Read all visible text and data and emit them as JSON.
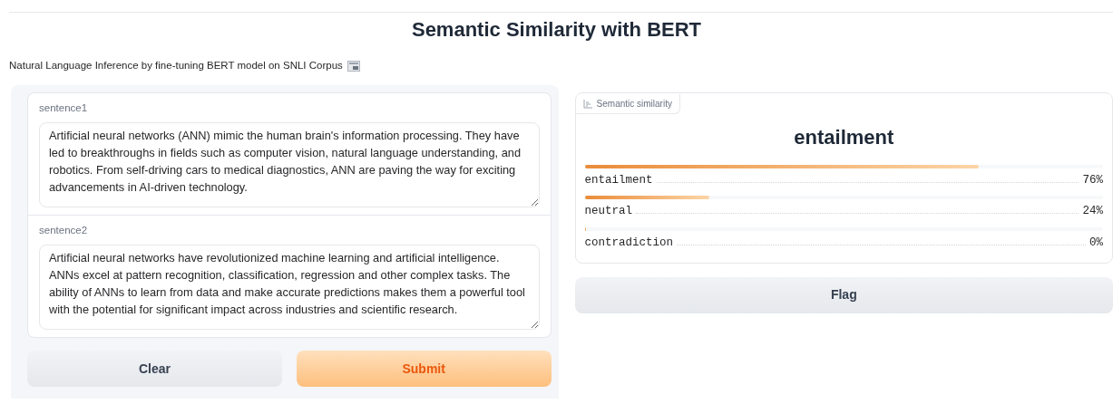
{
  "title": "Semantic Similarity with BERT",
  "description": "Natural Language Inference by fine-tuning BERT model on SNLI Corpus",
  "inputs": [
    {
      "label": "sentence1",
      "value": "Artificial neural networks (ANN) mimic the human brain's information processing. They have led to breakthroughs in fields such as computer vision, natural language understanding, and robotics. From self-driving cars to medical diagnostics, ANN are paving the way for exciting advancements in AI-driven technology."
    },
    {
      "label": "sentence2",
      "value": "Artificial neural networks have revolutionized machine learning and artificial intelligence. ANNs excel at pattern recognition, classification, regression and other complex tasks. The ability of ANNs to learn from data and make accurate predictions makes them a powerful tool with the potential for significant impact across industries and scientific research."
    }
  ],
  "buttons": [
    {
      "label": "Clear",
      "kind": "secondary"
    },
    {
      "label": "Submit",
      "kind": "primary"
    }
  ],
  "output": {
    "tab_label": "Semantic similarity",
    "prediction": "entailment",
    "confidences": [
      {
        "label": "entailment",
        "level": 0.76,
        "reading": "76%"
      },
      {
        "label": "neutral",
        "level": 0.24,
        "reading": "24%"
      },
      {
        "label": "contradiction",
        "level": 0,
        "reading": "0%"
      }
    ]
  },
  "flag_button": "Flag"
}
